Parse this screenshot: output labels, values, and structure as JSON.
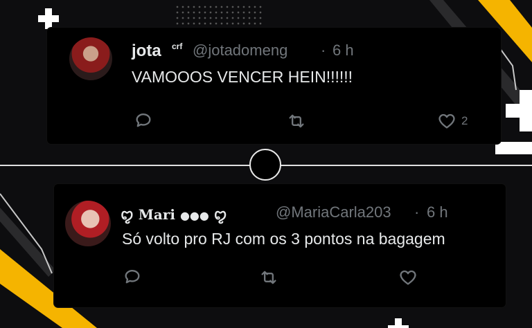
{
  "tweet1": {
    "display_name": "jota",
    "badge": "crf",
    "handle": "@jotadomeng",
    "separator": "·",
    "time": "6 h",
    "text": "VAMOOOS VENCER HEIN!!!!!!",
    "likes": "2"
  },
  "tweet2": {
    "display_name": "Mari",
    "handle": "@MariaCarla203",
    "separator": "·",
    "time": "6 h",
    "text": "Só volto pro RJ com os 3 pontos na bagagem"
  },
  "icons": {
    "reply": "reply-icon",
    "retweet": "retweet-icon",
    "like": "heart-icon"
  },
  "colors": {
    "background": "#0d0d0f",
    "card": "#000000",
    "accent_yellow": "#f5b400",
    "muted": "#71767b"
  }
}
